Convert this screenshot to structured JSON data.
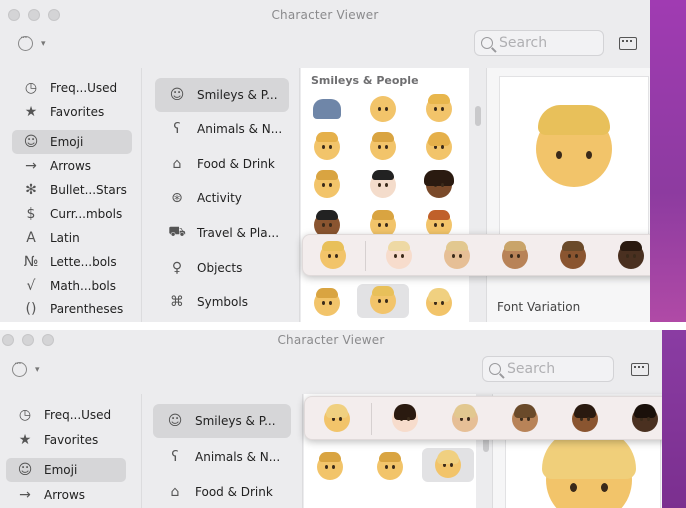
{
  "window": {
    "title": "Character Viewer"
  },
  "search": {
    "placeholder": "Search"
  },
  "sidebar": {
    "items": [
      {
        "label": "Freq...Used",
        "icon": "clock-icon"
      },
      {
        "label": "Favorites",
        "icon": "star-icon"
      },
      {
        "label": "Emoji",
        "icon": "smiley-icon"
      },
      {
        "label": "Arrows",
        "icon": "arrow-icon"
      },
      {
        "label": "Bullet...Stars",
        "icon": "asterisk-icon"
      },
      {
        "label": "Curr...mbols",
        "icon": "dollar-icon"
      },
      {
        "label": "Latin",
        "icon": "latin-a-icon"
      },
      {
        "label": "Lette...bols",
        "icon": "numero-icon"
      },
      {
        "label": "Math...bols",
        "icon": "sqrt-icon"
      },
      {
        "label": "Parentheses",
        "icon": "parentheses-icon"
      }
    ]
  },
  "categories": {
    "items": [
      {
        "label": "Smileys & P...",
        "icon": "smiley-icon"
      },
      {
        "label": "Animals & N...",
        "icon": "bear-icon"
      },
      {
        "label": "Food & Drink",
        "icon": "cake-icon"
      },
      {
        "label": "Activity",
        "icon": "ball-icon"
      },
      {
        "label": "Travel & Pla...",
        "icon": "car-icon"
      },
      {
        "label": "Objects",
        "icon": "bulb-icon"
      },
      {
        "label": "Symbols",
        "icon": "symbols-icon"
      }
    ]
  },
  "grid": {
    "title": "Smileys & People"
  },
  "preview": {
    "font_variation": "Font Variation"
  },
  "colors": {
    "accent_bg": "#a03bb2",
    "window_bg": "#ececee",
    "selection": "#d6d6d8"
  }
}
